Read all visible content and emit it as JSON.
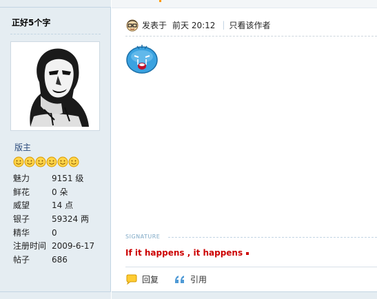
{
  "sidebar": {
    "username": "正好5个字",
    "group": "版主",
    "star_icons": [
      "smiley-icon",
      "smiley-icon",
      "smiley-icon",
      "smiley-icon",
      "smiley-icon",
      "smiley-icon"
    ],
    "stats": [
      {
        "label": "魅力",
        "value": "9151 级"
      },
      {
        "label": "鲜花",
        "value": "0 朵"
      },
      {
        "label": "威望",
        "value": "14 点"
      },
      {
        "label": "银子",
        "value": "59324 两"
      },
      {
        "label": "精华",
        "value": "0"
      },
      {
        "label": "注册时间",
        "value": "2009-6-17"
      },
      {
        "label": "帖子",
        "value": "686"
      }
    ]
  },
  "post": {
    "posted_label": "发表于",
    "posted_time": "前天 20:12",
    "separator": "|",
    "only_author": "只看该作者",
    "signature_label": "SIGNATURE",
    "signature_text": "If it happens , it happens",
    "actions": {
      "reply": "回复",
      "quote": "引用"
    }
  },
  "colors": {
    "sidebar_bg": "#e5edf2",
    "signature_red": "#cc0000",
    "group_blue": "#2b4b7c"
  }
}
